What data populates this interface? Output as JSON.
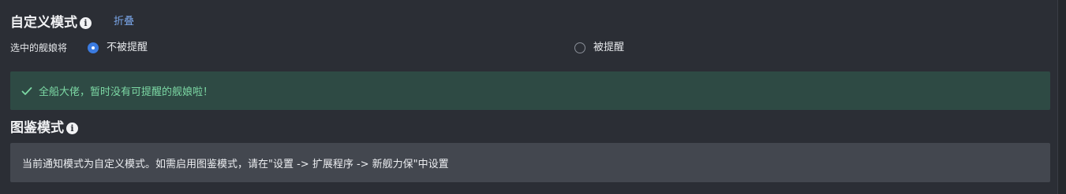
{
  "custom_mode": {
    "title": "自定义模式",
    "collapse_label": "折叠",
    "field_label": "选中的舰娘将",
    "options": [
      {
        "label": "不被提醒",
        "selected": true
      },
      {
        "label": "被提醒",
        "selected": false
      }
    ],
    "alert_text": "全船大佬，暂时没有可提醒的舰娘啦！"
  },
  "illustrated_mode": {
    "title": "图鉴模式",
    "notice_text": "当前通知模式为自定义模式。如需启用图鉴模式，请在\"设置 -> 扩展程序 -> 新舰力保\"中设置"
  },
  "colors": {
    "background": "#2b2e35",
    "accent": "#3b7be0",
    "link": "#7aa6e8",
    "success_bg": "#2e4a44",
    "success_text": "#7cd8a4",
    "info_bg": "#43474f"
  },
  "icons": {
    "info": "info-circle-icon",
    "success": "check-icon"
  }
}
